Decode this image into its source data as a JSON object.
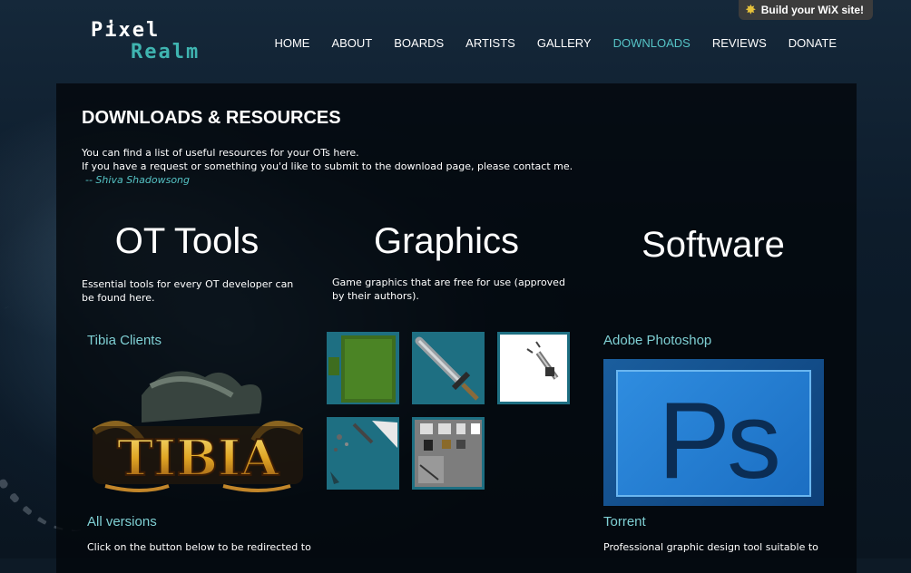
{
  "wix_banner": {
    "label": "Build your WiX site!"
  },
  "logo": {
    "line1": "Pixel",
    "line2": "Realm"
  },
  "nav": [
    {
      "label": "HOME"
    },
    {
      "label": "ABOUT"
    },
    {
      "label": "BOARDS"
    },
    {
      "label": "ARTISTS"
    },
    {
      "label": "GALLERY"
    },
    {
      "label": "DOWNLOADS",
      "active": true
    },
    {
      "label": "REVIEWS"
    },
    {
      "label": "DONATE"
    }
  ],
  "page": {
    "title": "DOWNLOADS & RESOURCES",
    "intro_line1": "You can find a list of useful resources for your OTs here.",
    "intro_line2": "If you have a request or something you'd like to submit to the download page, please contact me.",
    "signature": "-- Shiva Shadowsong"
  },
  "columns": {
    "ot_tools": {
      "heading": "OT Tools",
      "description": "Essential tools for every OT developer can be found here.",
      "item_title": "Tibia Clients",
      "item_image_text": "TIBIA",
      "link": "All versions",
      "paragraph": "Click on the button below to be redirected to"
    },
    "graphics": {
      "heading": "Graphics",
      "description": "Game graphics that are free for use (approved by their authors)."
    },
    "software": {
      "heading": "Software",
      "item_title": "Adobe Photoshop",
      "item_image_text": "Ps",
      "link": "Torrent",
      "paragraph": "Professional graphic design tool suitable to"
    }
  },
  "colors": {
    "accent": "#56c4c6",
    "panel": "#05090d",
    "thumb_bg": "#1e6f82"
  }
}
